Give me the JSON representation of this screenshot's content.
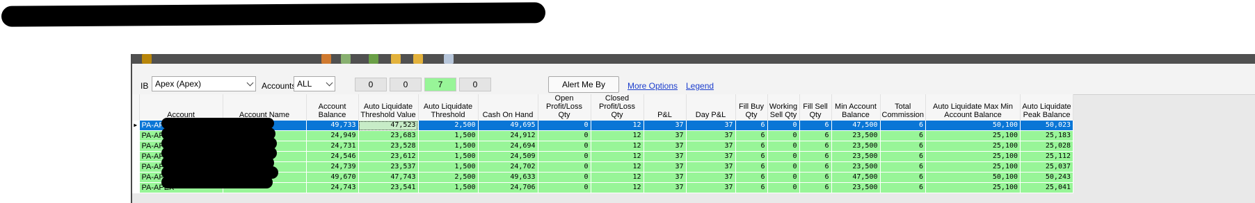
{
  "toolbar": {
    "ib_label": "IB",
    "ib_value": "Apex (Apex)",
    "accounts_label": "Accounts",
    "accounts_value": "ALL",
    "counters": [
      "0",
      "0",
      "7",
      "0"
    ],
    "alert_button": "Alert Me By",
    "more_options": "More Options",
    "legend": "Legend"
  },
  "colors": {
    "row_green": "#98f598",
    "selected_row": "#0a76d6",
    "link": "#1a3ccc"
  },
  "table": {
    "columns": [
      "Account",
      "Account Name",
      "Account Balance",
      "Auto Liquidate Threshold Value",
      "Auto Liquidate Threshold",
      "Cash On Hand",
      "Open Profit/Loss Qty",
      "Closed Profit/Loss Qty",
      "P&L",
      "Day P&L",
      "Fill Buy Qty",
      "Working Sell Qty",
      "Fill Sell Qty",
      "Min Account Balance",
      "Total Commission",
      "Auto Liquidate Max Min Account Balance",
      "Auto Liquidate Peak Balance"
    ],
    "rows": [
      [
        "PA-APEX",
        "",
        "49,733",
        "47,523",
        "2,500",
        "49,695",
        "0",
        "12",
        "37",
        "37",
        "6",
        "0",
        "6",
        "47,500",
        "6",
        "50,100",
        "50,023"
      ],
      [
        "PA-APEX",
        "",
        "24,949",
        "23,683",
        "1,500",
        "24,912",
        "0",
        "12",
        "37",
        "37",
        "6",
        "0",
        "6",
        "23,500",
        "6",
        "25,100",
        "25,183"
      ],
      [
        "PA-APEX",
        "",
        "24,731",
        "23,528",
        "1,500",
        "24,694",
        "0",
        "12",
        "37",
        "37",
        "6",
        "0",
        "6",
        "23,500",
        "6",
        "25,100",
        "25,028"
      ],
      [
        "PA-APEX",
        "",
        "24,546",
        "23,612",
        "1,500",
        "24,509",
        "0",
        "12",
        "37",
        "37",
        "6",
        "0",
        "6",
        "23,500",
        "6",
        "25,100",
        "25,112"
      ],
      [
        "PA-APEX",
        "",
        "24,739",
        "23,537",
        "1,500",
        "24,702",
        "0",
        "12",
        "37",
        "37",
        "6",
        "0",
        "6",
        "23,500",
        "6",
        "25,100",
        "25,037"
      ],
      [
        "PA-APEX",
        "",
        "49,670",
        "47,743",
        "2,500",
        "49,633",
        "0",
        "12",
        "37",
        "37",
        "6",
        "0",
        "6",
        "47,500",
        "6",
        "50,100",
        "50,243"
      ],
      [
        "PA-APEX",
        "",
        "24,743",
        "23,541",
        "1,500",
        "24,706",
        "0",
        "12",
        "37",
        "37",
        "6",
        "0",
        "6",
        "23,500",
        "6",
        "25,100",
        "25,041"
      ]
    ]
  }
}
